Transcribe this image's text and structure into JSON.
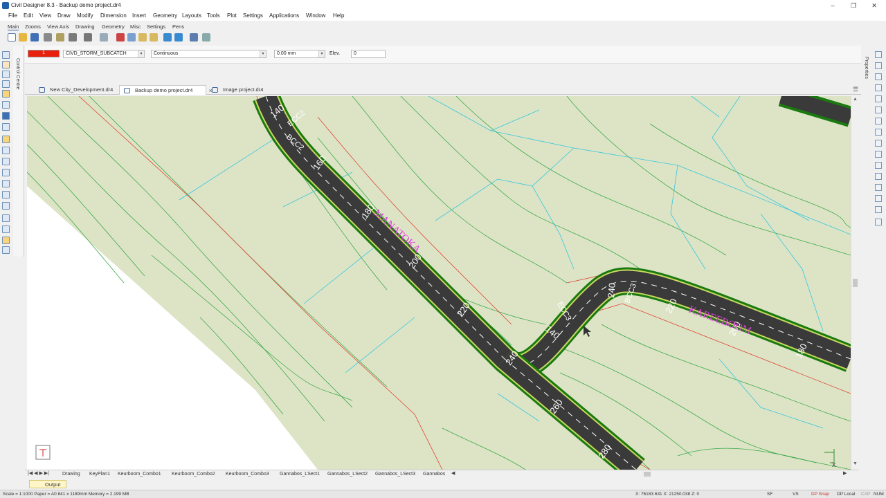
{
  "window": {
    "title": "Civil Designer 8.3 - Backup demo project.dr4"
  },
  "menu": [
    "File",
    "Edit",
    "View",
    "Draw",
    "Modify",
    "Dimension",
    "Insert",
    "Geometry",
    "Layouts",
    "Tools",
    "Plot",
    "Settings",
    "Applications",
    "Window",
    "Help"
  ],
  "ribbon_tabs": [
    "Main",
    "Zooms",
    "View Axis",
    "Drawing",
    "Geometry",
    "Misc",
    "Settings",
    "Pens"
  ],
  "properties": {
    "color_value": "1",
    "color": "#e8200e",
    "layer": "CIVD_STORM_SUBCATCH",
    "linetype": "Continuous",
    "lineweight": "0.00 mm",
    "elev_label": "Elev.",
    "elev_value": "0"
  },
  "panels": {
    "control_centre": "Control Centre",
    "properties": "Properties"
  },
  "document_tabs": [
    {
      "label": "New City_Development.dr4"
    },
    {
      "label": "Backup demo project.dr4",
      "close": "×"
    },
    {
      "label": "Image project.dr4"
    }
  ],
  "drawing": {
    "road_labels": [
      "140",
      "160",
      "180",
      "200",
      "220",
      "240",
      "260",
      "280",
      "240",
      "220",
      "200",
      "180",
      "140",
      "BCC2",
      "ECC2",
      "ECC3",
      "BCC3",
      "ECC3"
    ],
    "street_names": [
      "MANATOKA",
      "KAREEBOOM"
    ],
    "ucs_label": "X"
  },
  "layout_tabs": [
    "Drawing",
    "KeyPlan1",
    "Keurboom_Combo1",
    "Keurboom_Combo2",
    "Keurboom_Combo3",
    "Gannabos_LSect1",
    "Gannabos_LSect2",
    "Gannabos_LSect3",
    "Gannabos"
  ],
  "output_tab": "Output",
  "status": {
    "scale_info": "Scale = 1:1000 Paper = A0 841 x 1189mm Memory = 2.199 MB",
    "coords": "X: 76183.631 X: 21250.038 Z: 0",
    "sf": "SF",
    "vs": "VS",
    "dp_snap": "DP Snap",
    "dp_local": "DP Local",
    "cap": "CAP",
    "num": "NUM"
  }
}
